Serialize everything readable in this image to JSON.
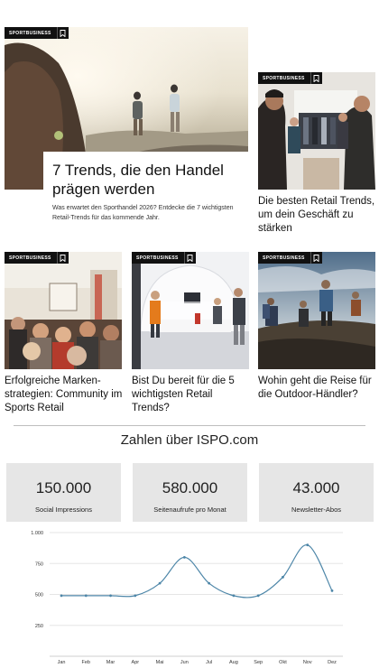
{
  "hero": {
    "category": "SPORTBUSINESS",
    "title": "7 Trends, die den Handel prägen werden",
    "description": "Was erwartet den Sporthandel 2026? Entdecke die 7 wichtigsten Retail-Trends für das kommende Jahr."
  },
  "side_article": {
    "category": "SPORTBUSINESS",
    "title": "Die besten Retail Trends, um dein Geschäft zu stärken"
  },
  "articles": [
    {
      "category": "SPORTBUSINESS",
      "title": "Erfolgreiche Marken­strategien: Community im Sports Retail"
    },
    {
      "category": "SPORTBUSINESS",
      "title": "Bist Du bereit für die 5 wichtigsten Retail Trends?"
    },
    {
      "category": "SPORTBUSINESS",
      "title": "Wohin geht die Reise für die Outdoor-Händler?"
    }
  ],
  "stats": {
    "heading": "Zahlen über ISPO.com",
    "items": [
      {
        "value": "150.000",
        "label": "Social Impressions"
      },
      {
        "value": "580.000",
        "label": "Seitenaufrufe pro Monat"
      },
      {
        "value": "43.000",
        "label": "Newsletter-Abos"
      }
    ]
  },
  "chart_data": {
    "type": "line",
    "categories": [
      "Jan",
      "Feb",
      "Mar",
      "Apr",
      "Mai",
      "Jun",
      "Jul",
      "Aug",
      "Sep",
      "Okt",
      "Nov",
      "Dez"
    ],
    "values": [
      490,
      490,
      490,
      490,
      590,
      800,
      590,
      490,
      490,
      640,
      900,
      530
    ],
    "yticks": [
      250,
      500,
      750,
      1000
    ],
    "ytick_labels": [
      "250",
      "500",
      "750",
      "1.000"
    ],
    "ylim": [
      0,
      1000
    ],
    "color": "#4d86a8",
    "grid": true
  }
}
